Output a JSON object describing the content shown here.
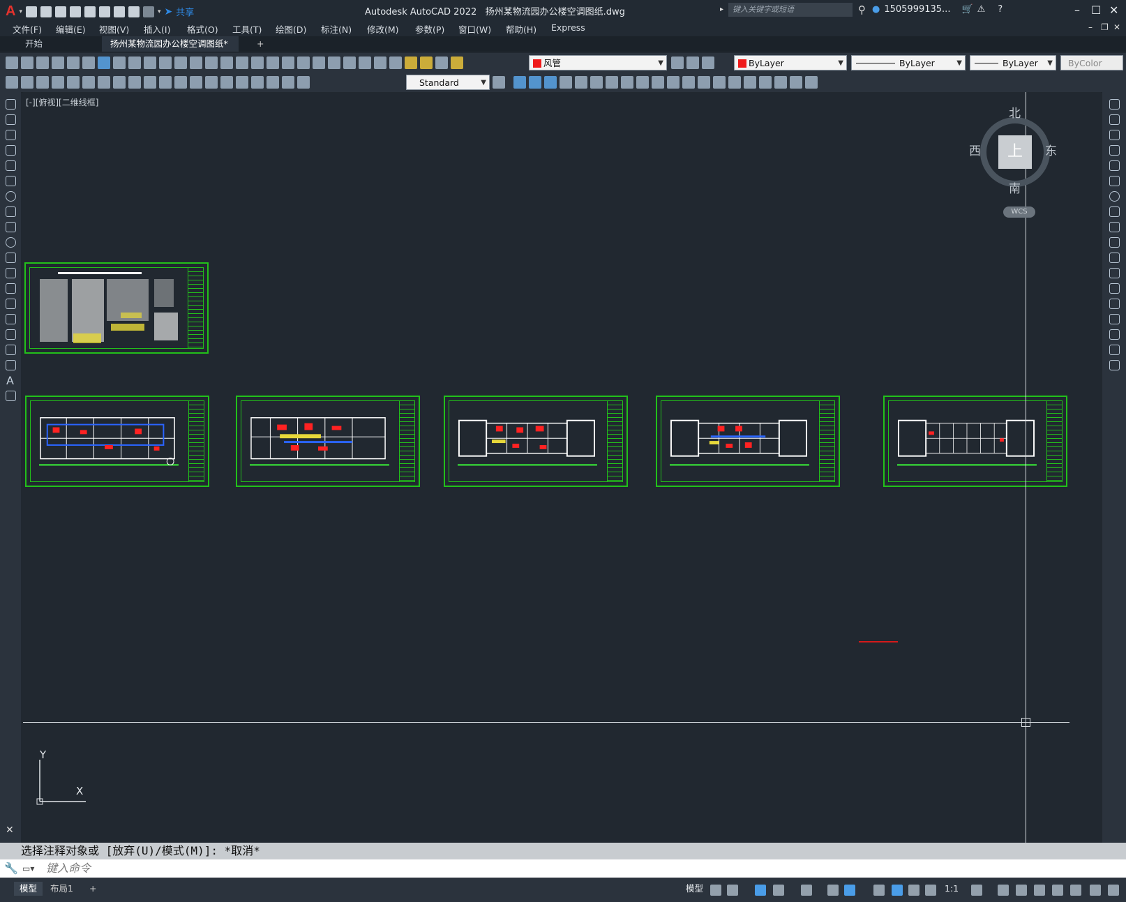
{
  "window": {
    "app_name": "Autodesk AutoCAD 2022",
    "file_name": "扬州某物流园办公楼空调图纸.dwg",
    "share_label": "共享",
    "search_placeholder": "键入关键字或短语",
    "user_name": "1505999135..."
  },
  "menu": [
    "文件(F)",
    "编辑(E)",
    "视图(V)",
    "插入(I)",
    "格式(O)",
    "工具(T)",
    "绘图(D)",
    "标注(N)",
    "修改(M)",
    "参数(P)",
    "窗口(W)",
    "帮助(H)",
    "Express"
  ],
  "tabs": {
    "start": "开始",
    "document": "扬州某物流园办公楼空调图纸*",
    "close": "✕",
    "add": "+"
  },
  "properties": {
    "layer": "风管",
    "color": "ByLayer",
    "linetype": "ByLayer",
    "lineweight": "ByLayer",
    "plotstyle": "ByColor",
    "text_style": "Standard",
    "accent_color": "#ef1a1a"
  },
  "viewport": {
    "label": "[-][俯视][二维线框]"
  },
  "viewcube": {
    "top_face": "上",
    "north": "北",
    "south": "南",
    "east": "东",
    "west": "西",
    "wcs": "WCS"
  },
  "ucs": {
    "x": "X",
    "y": "Y"
  },
  "command": {
    "history": "选择注释对象或 [放弃(U)/模式(M)]: *取消*",
    "placeholder": "键入命令"
  },
  "status": {
    "model_label": "模型",
    "model_tab": "模型",
    "layout_tab": "布局1",
    "scale": "1:1"
  },
  "colors": {
    "sheet_border": "#22c01a",
    "background": "#212830"
  }
}
